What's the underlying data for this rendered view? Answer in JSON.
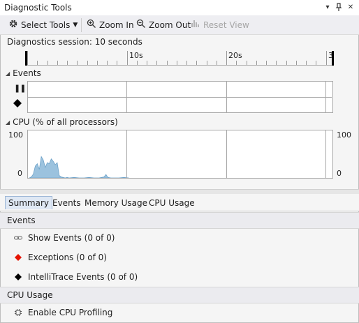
{
  "window": {
    "title": "Diagnostic Tools"
  },
  "toolbar": {
    "select_tools": "Select Tools",
    "zoom_in": "Zoom In",
    "zoom_out": "Zoom Out",
    "reset_view": "Reset View"
  },
  "session": {
    "label": "Diagnostics session: 10 seconds"
  },
  "ruler": {
    "labels": [
      "10s",
      "20s",
      "3"
    ]
  },
  "events_section": {
    "title": "Events"
  },
  "cpu_section": {
    "title": "CPU (% of all processors)",
    "y_max_left": "100",
    "y_min_left": "0",
    "y_max_right": "100",
    "y_min_right": "0",
    "fill_color": "#9bc2de"
  },
  "chart_data": {
    "type": "area",
    "title": "CPU (% of all processors)",
    "xlabel": "",
    "ylabel": "",
    "ylim": [
      0,
      100
    ],
    "x_unit": "s",
    "x": [
      0.0,
      0.2,
      0.4,
      0.6,
      0.8,
      1.0,
      1.2,
      1.4,
      1.6,
      1.8,
      2.0,
      2.2,
      2.4,
      2.6,
      2.8,
      3.0,
      3.2,
      3.4,
      3.6,
      3.8,
      4.0,
      4.5,
      5.0,
      5.5,
      6.0,
      6.5,
      7.0,
      7.5,
      7.7,
      7.9,
      8.2,
      9.0,
      9.5,
      10.0
    ],
    "values": [
      0,
      2,
      8,
      25,
      30,
      18,
      45,
      38,
      22,
      32,
      30,
      40,
      35,
      28,
      32,
      5,
      2,
      1,
      0,
      1,
      0,
      1,
      0,
      0,
      1,
      0,
      0,
      2,
      7,
      1,
      0,
      0,
      1,
      0
    ]
  },
  "tabs": [
    "Summary",
    "Events",
    "Memory Usage",
    "CPU Usage"
  ],
  "summary": {
    "events_group": "Events",
    "show_events": "Show Events (0 of 0)",
    "exceptions": "Exceptions (0 of 0)",
    "intellitrace": "IntelliTrace Events (0 of 0)",
    "cpu_group": "CPU Usage",
    "enable_cpu": "Enable CPU Profiling"
  },
  "colors": {
    "exception": "#e51400",
    "accent": "#dfe8f4"
  }
}
